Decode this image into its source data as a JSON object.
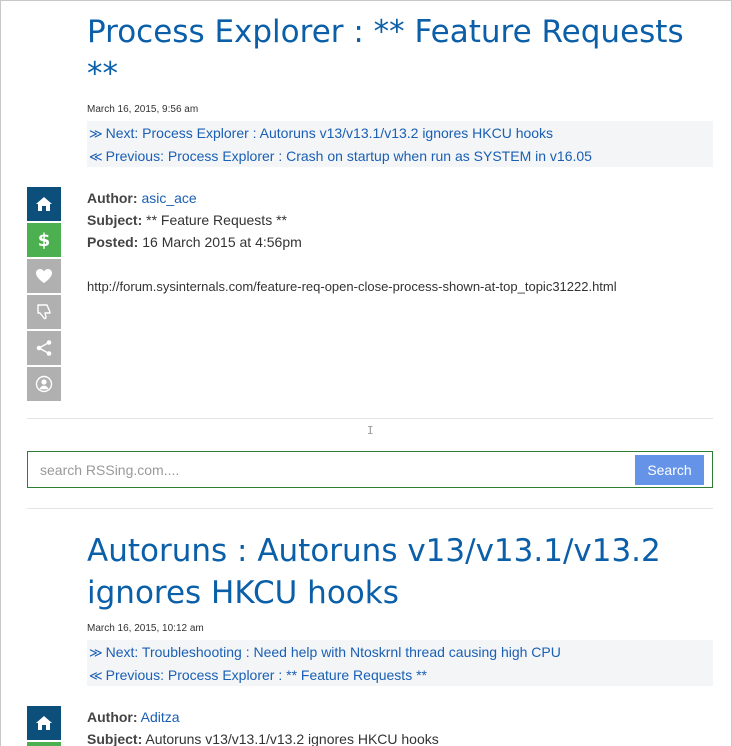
{
  "posts": [
    {
      "title": "Process Explorer : ** Feature Requests **",
      "date": "March 16, 2015, 9:56 am",
      "next_arrow": "≫",
      "next_label": "Next: Process Explorer : Autoruns v13/v13.1/v13.2 ignores HKCU hooks",
      "prev_arrow": "≪",
      "prev_label": "Previous: Process Explorer : Crash on startup when run as SYSTEM in v16.05",
      "author_label": "Author:",
      "author": "asic_ace",
      "subject_label": "Subject:",
      "subject": "** Feature Requests **",
      "posted_label": "Posted:",
      "posted": "16 March 2015 at 4:56pm",
      "body": "http://forum.sysinternals.com/feature-req-open-close-process-shown-at-top_topic31222.html"
    },
    {
      "title": "Autoruns : Autoruns v13/v13.1/v13.2 ignores HKCU hooks",
      "date": "March 16, 2015, 10:12 am",
      "next_arrow": "≫",
      "next_label": "Next: Troubleshooting : Need help with Ntoskrnl thread causing high CPU",
      "prev_arrow": "≪",
      "prev_label": "Previous: Process Explorer : ** Feature Requests **",
      "author_label": "Author:",
      "author": "Aditza",
      "subject_label": "Subject:",
      "subject": "Autoruns v13/v13.1/v13.2 ignores HKCU hooks"
    }
  ],
  "sidebar": {
    "items": [
      "home-icon",
      "dollar-icon",
      "heart-icon",
      "thumbs-down-icon",
      "share-icon",
      "user-icon"
    ],
    "dollar_glyph": "$"
  },
  "search": {
    "placeholder": "search RSSing.com....",
    "button_label": "Search"
  },
  "colors": {
    "title": "#0a5fa8",
    "link": "#1a5fb4",
    "home": "#0b4f7a",
    "money": "#4caf50",
    "grey_button": "#b0b0b0",
    "search_border": "#2e7d32",
    "search_button": "#6493e8"
  }
}
